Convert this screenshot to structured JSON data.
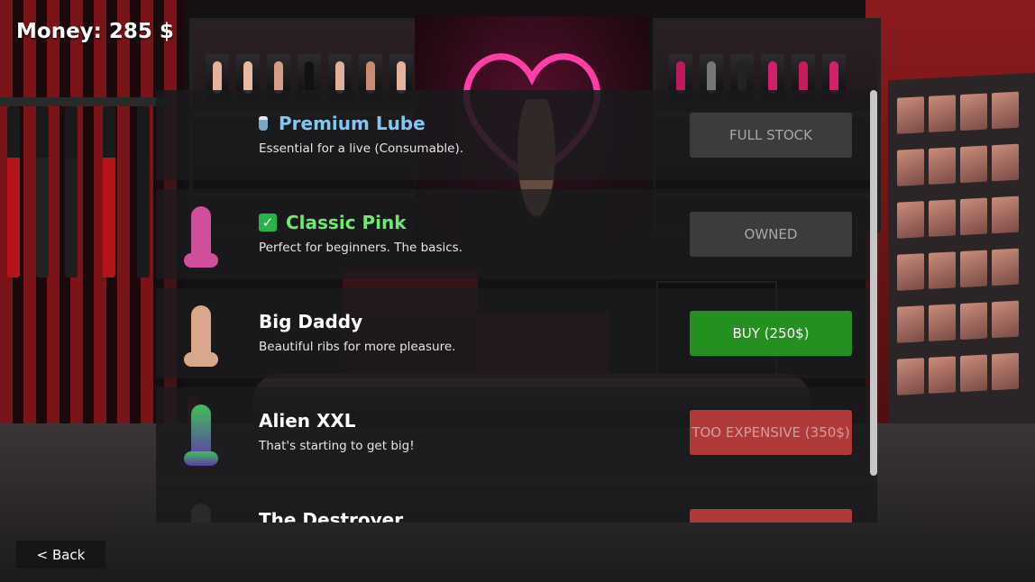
{
  "hud": {
    "money": "Money: 285 $",
    "back": "< Back"
  },
  "shop": {
    "items": [
      {
        "title": "Premium Lube",
        "description": "Essential for a live (Consumable).",
        "icon": "lube-bottle-icon",
        "title_color": "#7ec8f5",
        "action": "FULL STOCK",
        "state": "full-stock"
      },
      {
        "title": "Classic Pink",
        "description": "Perfect for beginners. The basics.",
        "icon": "check-icon",
        "title_color": "#6bea6b",
        "action": "OWNED",
        "state": "owned",
        "toy_color": "#d04f9a"
      },
      {
        "title": "Big Daddy",
        "description": "Beautiful ribs for more pleasure.",
        "title_color": "#ffffff",
        "action": "BUY (250$)",
        "state": "buyable",
        "toy_color": "#d9a88c"
      },
      {
        "title": "Alien XXL",
        "description": "That's starting to get big!",
        "title_color": "#ffffff",
        "action": "TOO EXPENSIVE (350$)",
        "state": "too-expensive",
        "toy_color": "#5e3aa8"
      },
      {
        "title": "The Destroyer",
        "description": "",
        "title_color": "#ffffff",
        "action": "",
        "state": "too-expensive",
        "toy_color": "#2a2a2a"
      }
    ]
  },
  "colors": {
    "buy": "#24901f",
    "too_expensive": "#b03a3a",
    "disabled": "#3c3c3e"
  }
}
